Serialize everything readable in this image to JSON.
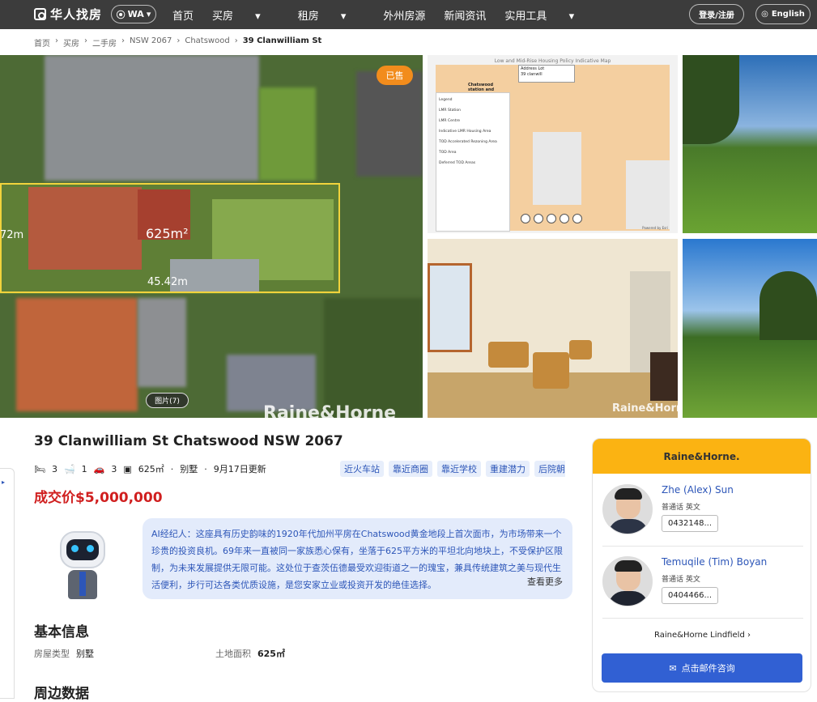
{
  "nav": {
    "brand": "华人找房",
    "location": "WA",
    "menu": [
      "首页",
      "买房",
      "租房",
      "外州房源",
      "新闻资讯",
      "实用工具"
    ],
    "login": "登录/注册",
    "lang": "English"
  },
  "breadcrumb": [
    "首页",
    "买房",
    "二手房",
    "NSW 2067",
    "Chatswood",
    "39 Clanwilliam St"
  ],
  "photos": {
    "sold_badge": "已售",
    "photo_count": "图片(7)",
    "watermark": "Raine&Horne",
    "lot_area": "625m²",
    "lot_width": "45.42m",
    "lot_side": "72m",
    "map_title": "Low and Mid-Rise Housing Policy Indicative Map",
    "map_label": "Chatswood station and",
    "map_legend": [
      "Legend",
      "LMR Station",
      "LMR Centre",
      "Indicative LMR Housing Area",
      "TOD Accelerated Rezoning Area",
      "TOD Area",
      "Deferred TOD Areas"
    ],
    "map_search": [
      "Address",
      "Lot",
      "39 clanwill"
    ],
    "map_credit": "Powered by Esri"
  },
  "listing": {
    "title": "39 Clanwilliam St Chatswood NSW 2067",
    "beds": "3",
    "baths": "1",
    "cars": "3",
    "land": "625㎡",
    "type": "别墅",
    "updated": "9月17日更新",
    "price": "成交价$5,000,000",
    "tags": [
      "近火车站",
      "靠近商圈",
      "靠近学校",
      "重建潜力",
      "后院朝北"
    ]
  },
  "ai": {
    "text": "AI经纪人：这座具有历史韵味的1920年代加州平房在Chatswood黄金地段上首次面市，为市场带来一个珍贵的投资良机。69年来一直被同一家族悉心保有，坐落于625平方米的平坦北向地块上，不受保护区限制，为未来发展提供无限可能。这处位于查茨伍德最受欢迎街道之一的瑰宝，兼具传统建筑之美与现代生活便利，步行可达各类优质设施，是您安家立业或投资开发的绝佳选择。",
    "more": "查看更多"
  },
  "basic": {
    "title": "基本信息",
    "type_label": "房屋类型",
    "type_value": "别墅",
    "land_label": "土地面积",
    "land_value": "625㎡"
  },
  "nearby": {
    "title": "周边数据"
  },
  "agency": {
    "name": "Raine&Horne.",
    "office": "Raine&Horne Lindfield",
    "email_btn": "点击邮件咨询",
    "agents": [
      {
        "name": "Zhe (Alex) Sun",
        "langs": "普通话  英文",
        "phone": "0432148..."
      },
      {
        "name": "Temuqile (Tim) Boyan",
        "langs": "普通话  英文",
        "phone": "0404466..."
      }
    ]
  },
  "colors": {
    "accent": "#3160d3",
    "price": "#d01f1f",
    "agency": "#fbb312",
    "sold": "#f28c1c"
  }
}
